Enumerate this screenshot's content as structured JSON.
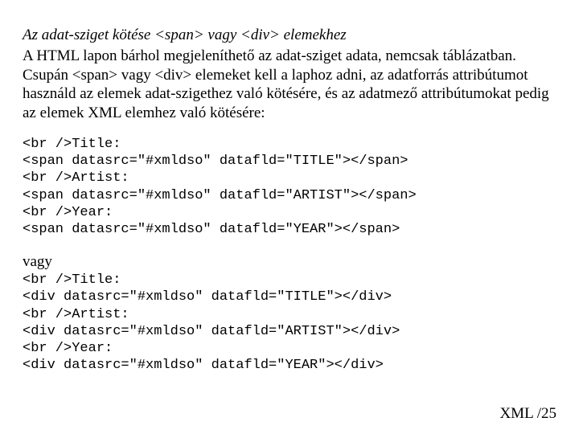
{
  "heading_italic": "Az adat-sziget kötése <span> vagy <div> elemekhez",
  "body_text": "A HTML lapon bárhol megjeleníthető az adat-sziget adata, nemcsak táblázatban. Csupán <span> vagy <div> elemeket kell a laphoz adni, az adatforrás attribútumot használd az elemek adat-szigethez való kötésére, és az adatmező attribútumokat pedig az elemek XML elemhez való kötésére:",
  "code_block_1": "<br />Title:\n<span datasrc=\"#xmldso\" datafld=\"TITLE\"></span>\n<br />Artist:\n<span datasrc=\"#xmldso\" datafld=\"ARTIST\"></span>\n<br />Year:\n<span datasrc=\"#xmldso\" datafld=\"YEAR\"></span>",
  "subheading": "vagy",
  "code_block_2": "<br />Title:\n<div datasrc=\"#xmldso\" datafld=\"TITLE\"></div>\n<br />Artist:\n<div datasrc=\"#xmldso\" datafld=\"ARTIST\"></div>\n<br />Year:\n<div datasrc=\"#xmldso\" datafld=\"YEAR\"></div>",
  "footer": "XML /25"
}
